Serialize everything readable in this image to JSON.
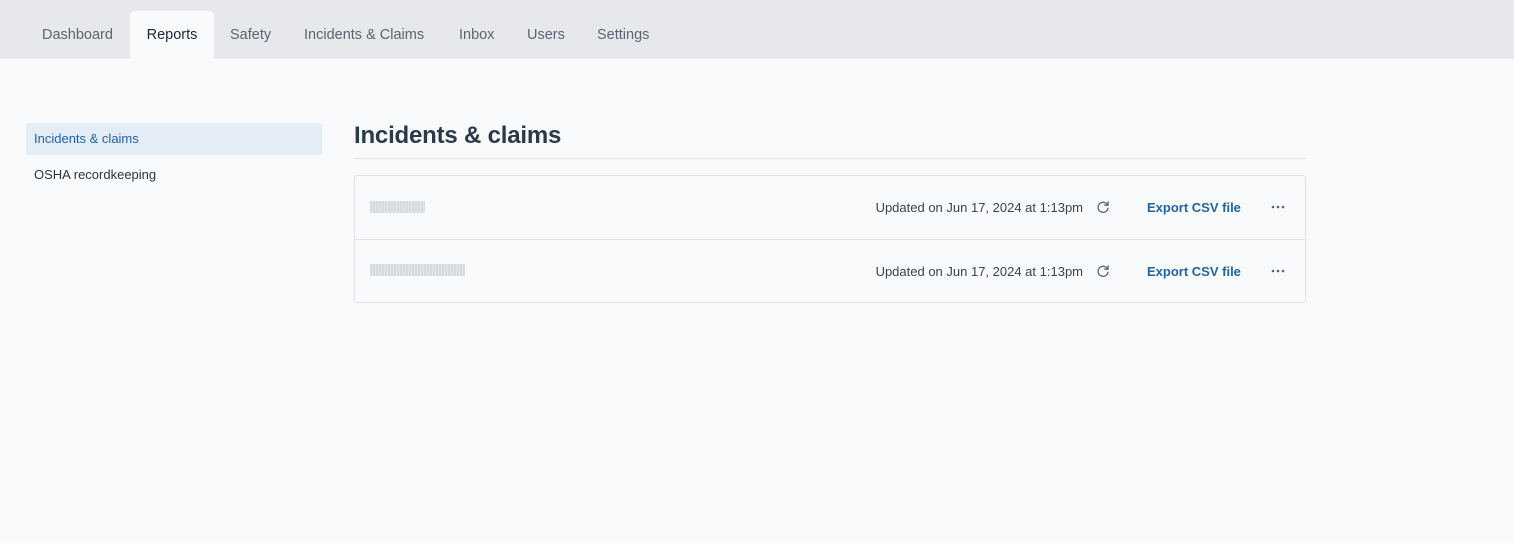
{
  "nav": {
    "tabs": [
      {
        "label": "Dashboard"
      },
      {
        "label": "Reports"
      },
      {
        "label": "Safety"
      },
      {
        "label": "Incidents & Claims"
      },
      {
        "label": "Inbox"
      },
      {
        "label": "Users"
      },
      {
        "label": "Settings"
      }
    ],
    "active_tab": "Reports"
  },
  "sidebar": {
    "items": [
      {
        "label": "Incidents & claims",
        "active": true
      },
      {
        "label": "OSHA recordkeeping",
        "active": false
      }
    ]
  },
  "main": {
    "title": "Incidents & claims",
    "reports": [
      {
        "name": "",
        "updated": "Updated on Jun 17, 2024 at 1:13pm",
        "export_label": "Export CSV file",
        "refresh_icon": "refresh-icon",
        "more_icon": "ellipsis-icon"
      },
      {
        "name": "",
        "updated": "Updated on Jun 17, 2024 at 1:13pm",
        "export_label": "Export CSV file",
        "refresh_icon": "refresh-icon",
        "more_icon": "ellipsis-icon"
      }
    ]
  },
  "colors": {
    "accent": "#1f63a8",
    "topbar_bg": "#e7e8eb",
    "page_bg": "#f9fafc",
    "active_sidebar_bg": "#e4edf6",
    "border": "#dfe2e7"
  }
}
